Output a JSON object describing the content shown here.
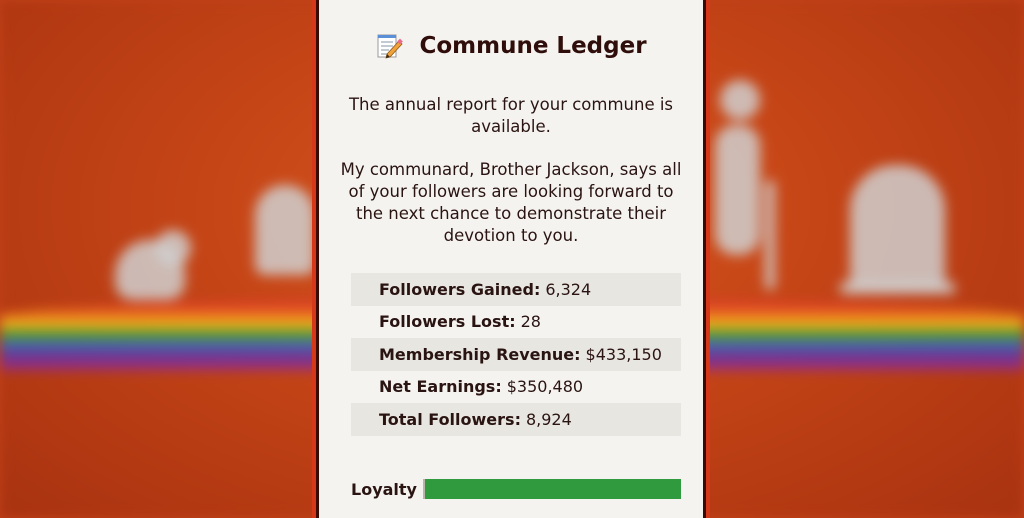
{
  "modal": {
    "title": "Commune Ledger",
    "title_icon": "memo-icon",
    "message_1": "The annual report for your commune is available.",
    "message_2": "My communard, Brother Jackson, says all of your followers are looking forward to the next chance to demonstrate their devotion to you."
  },
  "stats": [
    {
      "label": "Followers Gained:",
      "value": "6,324"
    },
    {
      "label": "Followers Lost:",
      "value": "28"
    },
    {
      "label": "Membership Revenue:",
      "value": "$433,150"
    },
    {
      "label": "Net Earnings:",
      "value": "$350,480"
    },
    {
      "label": "Total Followers:",
      "value": "8,924"
    }
  ],
  "loyalty": {
    "label": "Loyalty",
    "level_fraction": 1.0,
    "color": "#2f9a3e"
  },
  "colors": {
    "accent_border": "#d6381a",
    "panel_bg": "#f5f3ef",
    "title_text": "#2e0d0a"
  }
}
